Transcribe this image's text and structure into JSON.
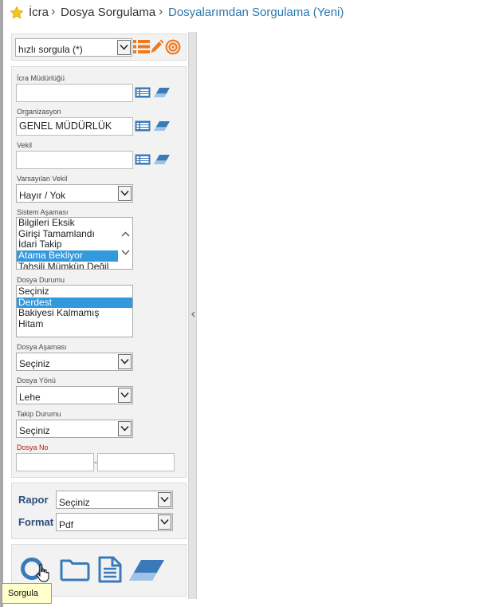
{
  "breadcrumb": {
    "items": [
      "İcra",
      "Dosya Sorgulama",
      "Dosyalarımdan Sorgulama (Yeni)"
    ],
    "separator": "›"
  },
  "quick_query": {
    "value": "hızlı sorgula (*)"
  },
  "fields": {
    "icra_mudurlugu": {
      "label": "İcra Müdürlüğü",
      "value": ""
    },
    "organizasyon": {
      "label": "Organizasyon",
      "value": "GENEL MÜDÜRLÜK"
    },
    "vekil": {
      "label": "Vekil",
      "value": ""
    },
    "varsayilan_vekil": {
      "label": "Varsayılan Vekil",
      "value": "Hayır / Yok"
    },
    "sistem_asamasi": {
      "label": "Sistem Aşaması",
      "options": [
        "Bilgileri Eksik",
        "Girişi Tamamlandı",
        "İdari Takip",
        "Atama Bekliyor",
        "Tahsili Mümkün Değil"
      ],
      "selected": "Atama Bekliyor"
    },
    "dosya_durumu": {
      "label": "Dosya Durumu",
      "options": [
        "Seçiniz",
        "Derdest",
        "Bakiyesi Kalmamış",
        "Hitam"
      ],
      "selected": "Derdest"
    },
    "dosya_asamasi": {
      "label": "Dosya Aşaması",
      "value": "Seçiniz"
    },
    "dosya_yonu": {
      "label": "Dosya Yönü",
      "value": "Lehe"
    },
    "takip_durumu": {
      "label": "Takip Durumu",
      "value": "Seçiniz"
    },
    "dosya_no": {
      "label": "Dosya No",
      "from": "",
      "to": "",
      "separator": "-"
    }
  },
  "report": {
    "rapor_label": "Rapor",
    "rapor_value": "Seçiniz",
    "format_label": "Format",
    "format_value": "Pdf"
  },
  "tooltip": "Sorgula",
  "colors": {
    "accent": "#3a7ab8",
    "link": "#2a78b0",
    "selection": "#3399dd",
    "orange": "#f0781e",
    "required": "#b31b1b",
    "label_blue": "#2b4f7b"
  }
}
